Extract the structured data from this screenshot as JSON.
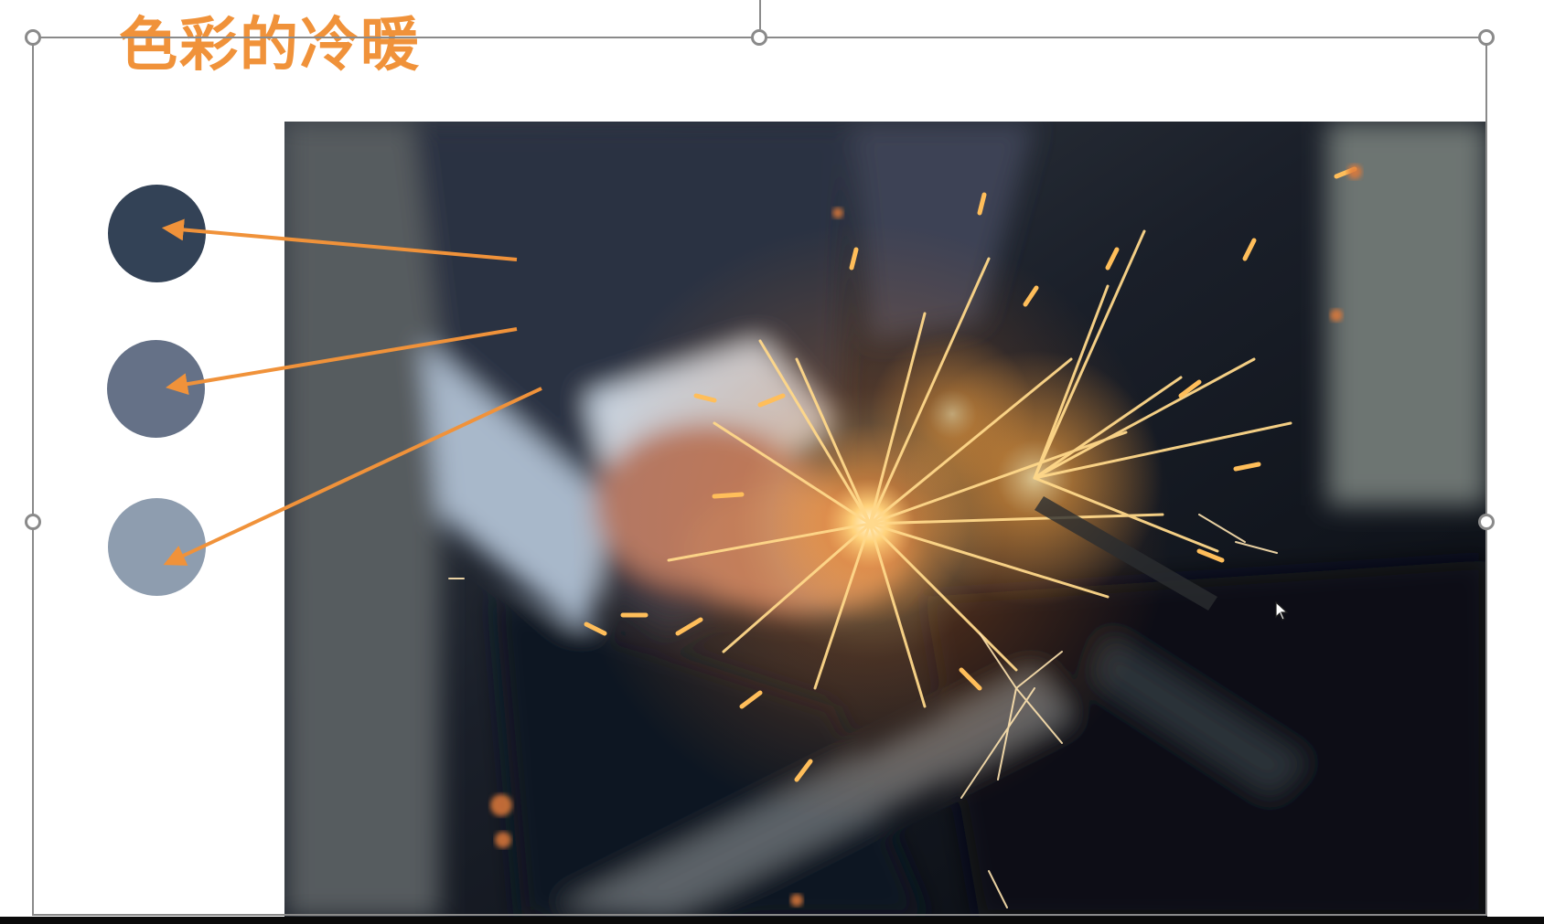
{
  "slide": {
    "title": "色彩的冷暖",
    "title_color": "#f0923a",
    "image_icon": "sparkler-photo"
  },
  "swatches": [
    {
      "name": "dark-navy",
      "color": "#334256"
    },
    {
      "name": "slate-gray",
      "color": "#657187"
    },
    {
      "name": "light-blue-gray",
      "color": "#8e9daf"
    }
  ],
  "colors": {
    "arrow": "#f0923a",
    "selection_border": "#8a8a8a"
  }
}
